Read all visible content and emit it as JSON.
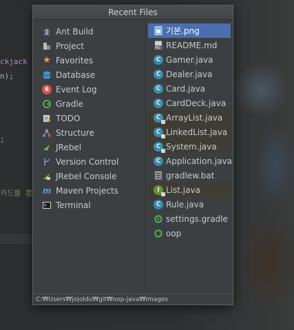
{
  "editor": {
    "lines": [
      {
        "text": "ckjack =",
        "color": "#b389c5"
      },
      {
        "text": "n);",
        "color": "#a9b7c6"
      },
      {
        "text": ";",
        "color": "#a9b7c6"
      },
      {
        "text": "카드를 뽑",
        "color": "#629755"
      }
    ]
  },
  "popup": {
    "title": "Recent Files",
    "tool_windows": [
      {
        "label": "Ant Build",
        "icon": "ant-build-icon",
        "color": "#9b8fb8"
      },
      {
        "label": "Project",
        "icon": "project-icon",
        "color": "#b8b8b8"
      },
      {
        "label": "Favorites",
        "icon": "favorites-star-icon",
        "color": "#e8a33c"
      },
      {
        "label": "Database",
        "icon": "database-icon",
        "color": "#4a9fd8"
      },
      {
        "label": "Event Log",
        "icon": "event-log-icon",
        "badge": "6",
        "color": "#d9534f"
      },
      {
        "label": "Gradle",
        "icon": "gradle-icon",
        "color": "#4fb04f"
      },
      {
        "label": "TODO",
        "icon": "todo-icon",
        "color": "#d0d0d0"
      },
      {
        "label": "Structure",
        "icon": "structure-icon",
        "color": "#c27dc2"
      },
      {
        "label": "JRebel",
        "icon": "jrebel-icon",
        "color": "#7cc043"
      },
      {
        "label": "Version Control",
        "icon": "version-control-icon",
        "color": "#8aa9c8"
      },
      {
        "label": "JRebel Console",
        "icon": "jrebel-console-icon",
        "color": "#7cc043"
      },
      {
        "label": "Maven Projects",
        "icon": "maven-icon",
        "color": "#5a9fd6"
      },
      {
        "label": "Terminal",
        "icon": "terminal-icon",
        "color": "#d0d0d0"
      }
    ],
    "files": [
      {
        "label": "기본.png",
        "icon": "image-file-icon",
        "state": "selected"
      },
      {
        "label": "README.md",
        "icon": "markdown-file-icon",
        "state": ""
      },
      {
        "label": "Gamer.java",
        "icon": "java-class-icon",
        "state": ""
      },
      {
        "label": "Dealer.java",
        "icon": "java-class-icon",
        "state": ""
      },
      {
        "label": "Card.java",
        "icon": "java-class-icon",
        "state": ""
      },
      {
        "label": "CardDeck.java",
        "icon": "java-class-icon",
        "state": ""
      },
      {
        "label": "ArrayList.java",
        "icon": "java-locked-class-icon",
        "state": "tint"
      },
      {
        "label": "LinkedList.java",
        "icon": "java-locked-class-icon",
        "state": "tint"
      },
      {
        "label": "System.java",
        "icon": "java-locked-class-icon",
        "state": "tint"
      },
      {
        "label": "Application.java",
        "icon": "java-class-icon",
        "state": ""
      },
      {
        "label": "gradlew.bat",
        "icon": "batch-file-icon",
        "state": ""
      },
      {
        "label": "List.java",
        "icon": "java-interface-icon",
        "state": "tint"
      },
      {
        "label": "Rule.java",
        "icon": "java-class-icon",
        "state": ""
      },
      {
        "label": "settings.gradle",
        "icon": "gradle-file-icon",
        "state": ""
      },
      {
        "label": "oop",
        "icon": "module-icon",
        "state": ""
      }
    ],
    "path": "C:₩Users₩jojoldu₩git₩oop-java₩images"
  }
}
